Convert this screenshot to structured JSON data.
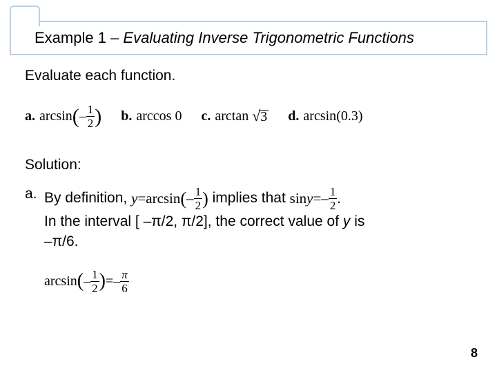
{
  "title": {
    "prefix": "Example 1 – ",
    "italic": "Evaluating Inverse Trigonometric Functions"
  },
  "prompt": "Evaluate each function.",
  "problems": {
    "a": {
      "label": "a.",
      "func": "arcsin",
      "neg": "–",
      "num": "1",
      "den": "2"
    },
    "b": {
      "label": "b.",
      "func": "arccos",
      "arg": "0"
    },
    "c": {
      "label": "c.",
      "func": "arctan",
      "rad": "3"
    },
    "d": {
      "label": "d.",
      "func": "arcsin",
      "arg": "(0.3)"
    }
  },
  "solution_label": "Solution:",
  "a_label": "a.",
  "a_text": {
    "seg1": " By definition, ",
    "def_lhs_var": "y",
    "def_eq": " = ",
    "def_func": "arcsin",
    "def_neg": "–",
    "def_num": "1",
    "def_den": "2",
    "seg2": " implies that ",
    "imp_func": "sin ",
    "imp_var": "y",
    "imp_eq": " = ",
    "imp_neg": "–",
    "imp_num": "1",
    "imp_den": "2",
    "period": ".",
    "seg3": "In the interval [ –π/2, π/2], the correct value of ",
    "ital_y": "y",
    "seg4": " is",
    "seg5": "–π/6."
  },
  "final": {
    "func": "arcsin",
    "lneg": "–",
    "lnum": "1",
    "lden": "2",
    "eq": " = ",
    "rneg": "– ",
    "rnum": "π",
    "rden": "6"
  },
  "page": "8"
}
